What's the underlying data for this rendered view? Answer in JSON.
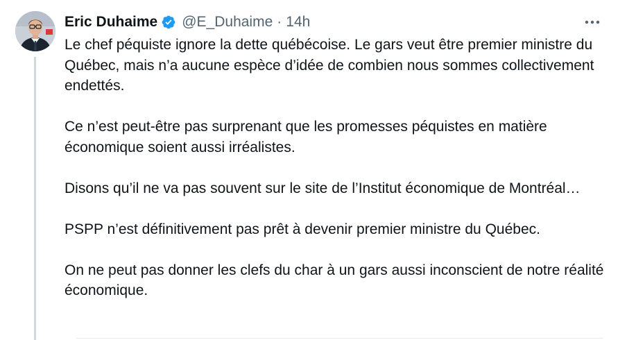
{
  "tweet": {
    "author_name": "Eric Duhaime",
    "handle": "@E_Duhaime",
    "separator": "·",
    "timestamp": "14h",
    "paragraphs": [
      "Le chef péquiste ignore la dette québécoise. Le gars veut être premier ministre du Québec, mais n’a aucune espèce d’idée de combien nous sommes collectivement endettés.",
      "Ce n’est peut-être pas surprenant que les promesses péquistes en matière économique soient aussi irréalistes.",
      "Disons qu’il ne va pas souvent sur le site de l’Institut économique de Montréal…",
      "PSPP n’est définitivement pas prêt à devenir premier ministre du Québec.",
      "On ne peut pas donner les clefs du char à un gars aussi inconscient de notre réalité économique."
    ]
  },
  "icons": {
    "verified": "verified-badge-icon",
    "more": "more-options-icon"
  },
  "colors": {
    "verified_blue": "#1d9bf0",
    "text_primary": "#0f1419",
    "text_secondary": "#536471",
    "thread_line": "#cfd9de"
  }
}
